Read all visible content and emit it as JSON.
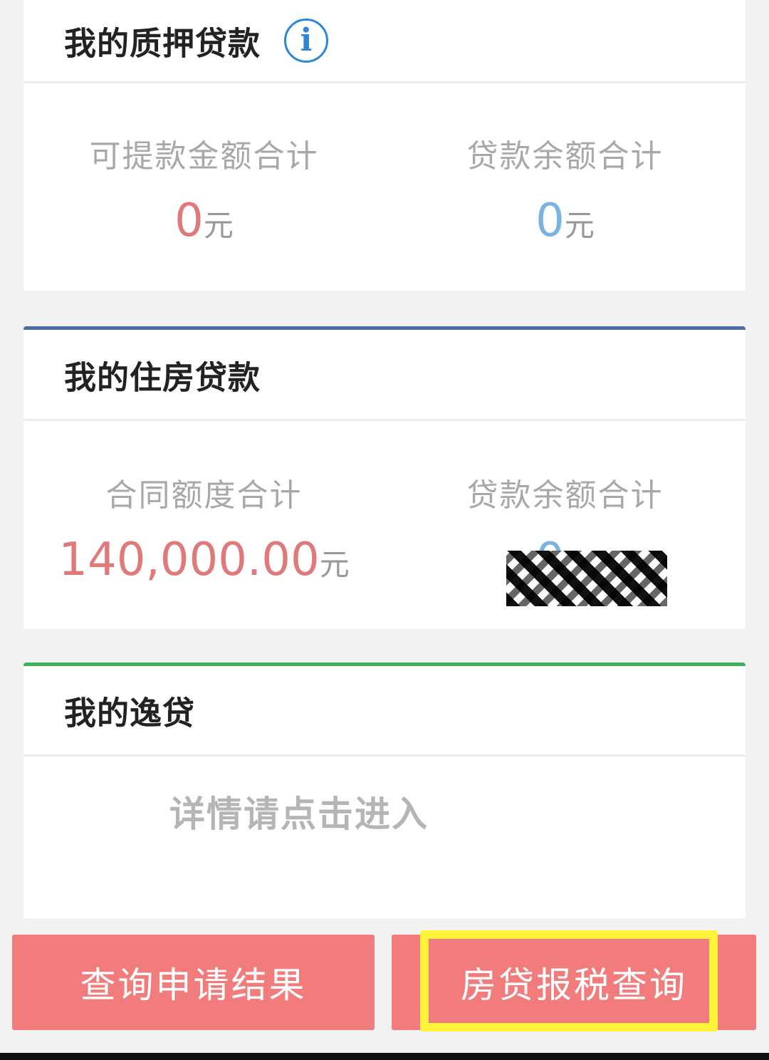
{
  "pledge_loan": {
    "title": "我的质押贷款",
    "info_icon": "info-icon",
    "withdrawable": {
      "label": "可提款金额合计",
      "value": "0",
      "unit": "元"
    },
    "balance": {
      "label": "贷款余额合计",
      "value": "0",
      "unit": "元"
    }
  },
  "housing_loan": {
    "title": "我的住房贷款",
    "accent": "#4a6fa5",
    "contract": {
      "label": "合同额度合计",
      "value": "140,000.00",
      "unit": "元"
    },
    "balance": {
      "label": "贷款余额合计",
      "value": "0",
      "unit": "元"
    }
  },
  "easy_loan": {
    "title": "我的逸贷",
    "accent": "#3cb55a",
    "hint": "详情请点击进入"
  },
  "buttons": {
    "query_result": "查询申请结果",
    "tax_query": "房贷报税查询"
  },
  "colors": {
    "button": "#f27c7c",
    "highlight": "#fff23a"
  }
}
